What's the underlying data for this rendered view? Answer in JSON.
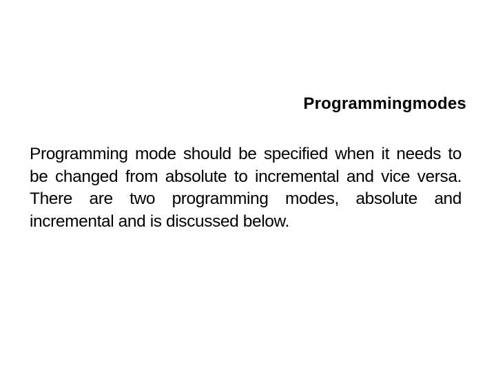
{
  "slide": {
    "title": "Programmingmodes",
    "body": "Programming mode should be specified when it needs to be changed from absolute to incremental and vice versa. There are two programming modes, absolute and incremental and is discussed below."
  }
}
